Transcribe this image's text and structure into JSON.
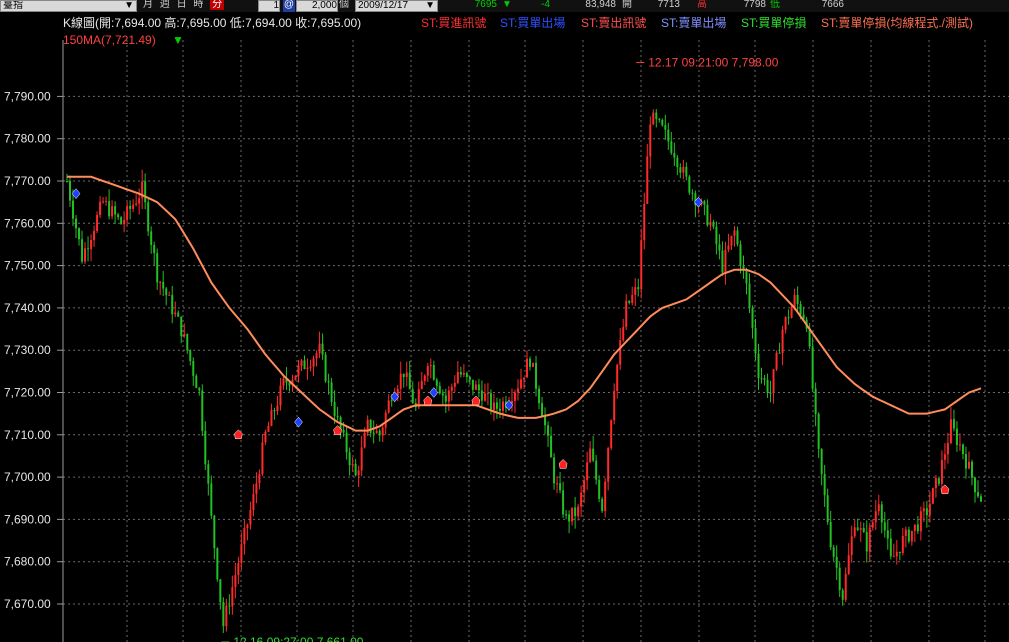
{
  "toolbar": {
    "symbol": "臺指",
    "periods": [
      "月",
      "週",
      "日",
      "時",
      "分"
    ],
    "period_selected": "分",
    "interval": "1",
    "quantity": "2,000",
    "unit": "個",
    "date": "2009/12/17",
    "last": "7695",
    "change": "-4",
    "volume": "83,948",
    "open_label": "開",
    "open_value": "7713",
    "high_label": "高",
    "high_value": "7798",
    "low_label": "低",
    "low_value": "7666",
    "colors": {
      "down": "#00d000",
      "up": "#ff3030",
      "high": "#ff3030",
      "low": "#00d000"
    }
  },
  "info": {
    "kline": "K線圖(開:7,694.00 高:7,695.00 低:7,694.00 收:7,695.00)",
    "st_buy_signal": "ST:買進訊號",
    "st_buy_exit": "ST:買單出場",
    "st_sell_signal": "ST:賣出訊號",
    "st_sell_exit": "ST:賣單出場",
    "st_buy_stop": "ST:買單停損",
    "st_sell_stop": "ST:賣單停損(均線程式./測試)",
    "ma_label": "150MA(7,721.49)",
    "colors": {
      "kline": "#e8e8e8",
      "buy_signal": "#ff3030",
      "buy_exit": "#3050ff",
      "sell_signal": "#ff5050",
      "sell_exit": "#8090ff",
      "buy_stop": "#30e030",
      "sell_stop": "#ff7050",
      "ma": "#ff4040"
    }
  },
  "chart_data": {
    "type": "line",
    "title": "",
    "y_ticks": [
      7670,
      7680,
      7690,
      7700,
      7710,
      7720,
      7730,
      7740,
      7750,
      7760,
      7770,
      7780,
      7790
    ],
    "tick_labels": [
      "7,670.00",
      "7,680.00",
      "7,690.00",
      "7,700.00",
      "7,710.00",
      "7,720.00",
      "7,730.00",
      "7,740.00",
      "7,750.00",
      "7,760.00",
      "7,770.00",
      "7,780.00",
      "7,790.00"
    ],
    "ylim": [
      7661,
      7800
    ],
    "grid": true,
    "n_bars": 305,
    "series": [
      {
        "name": "price",
        "color": "#22c022",
        "x": [
          0,
          5,
          12,
          18,
          25,
          30,
          38,
          44,
          48,
          52,
          58,
          62,
          66,
          72,
          78,
          84,
          90,
          96,
          100,
          104,
          108,
          112,
          116,
          120,
          126,
          130,
          134,
          138,
          142,
          146,
          150,
          154,
          158,
          162,
          166,
          170,
          174,
          178,
          182,
          186,
          190,
          194,
          198,
          202,
          206,
          210,
          214,
          218,
          222,
          226,
          230,
          234,
          238,
          242,
          246,
          250,
          254,
          258,
          262,
          266,
          270,
          274,
          278,
          282,
          286,
          290,
          294,
          298,
          302,
          304
        ],
        "y": [
          7770,
          7752,
          7765,
          7760,
          7768,
          7748,
          7735,
          7720,
          7690,
          7665,
          7683,
          7695,
          7710,
          7722,
          7726,
          7730,
          7713,
          7700,
          7712,
          7710,
          7720,
          7725,
          7716,
          7728,
          7718,
          7725,
          7722,
          7720,
          7716,
          7718,
          7722,
          7728,
          7716,
          7700,
          7690,
          7692,
          7706,
          7693,
          7722,
          7740,
          7745,
          7785,
          7782,
          7777,
          7770,
          7765,
          7760,
          7750,
          7758,
          7745,
          7725,
          7720,
          7735,
          7742,
          7737,
          7705,
          7685,
          7672,
          7690,
          7684,
          7695,
          7680,
          7685,
          7688,
          7692,
          7700,
          7712,
          7706,
          7698,
          7695
        ]
      },
      {
        "name": "150MA",
        "color": "#ff8c5a",
        "x": [
          0,
          8,
          16,
          24,
          30,
          36,
          42,
          48,
          54,
          60,
          66,
          72,
          78,
          84,
          90,
          96,
          100,
          104,
          108,
          112,
          116,
          120,
          124,
          128,
          132,
          136,
          140,
          144,
          150,
          156,
          162,
          166,
          170,
          174,
          178,
          182,
          186,
          190,
          194,
          198,
          202,
          206,
          210,
          214,
          218,
          222,
          226,
          230,
          234,
          238,
          242,
          246,
          250,
          256,
          262,
          268,
          274,
          280,
          286,
          292,
          296,
          300,
          304
        ],
        "y": [
          7771,
          7771,
          7769,
          7767,
          7765,
          7761,
          7754,
          7746,
          7740,
          7735,
          7729,
          7724,
          7720,
          7716,
          7713,
          7711,
          7711,
          7712,
          7714,
          7716,
          7717,
          7717,
          7717,
          7717,
          7717,
          7717,
          7716,
          7715,
          7714,
          7714,
          7715,
          7716,
          7718,
          7721,
          7725,
          7729,
          7732,
          7735,
          7738,
          7740,
          7741,
          7742,
          7744,
          7746,
          7748,
          7749,
          7749,
          7748,
          7746,
          7743,
          7740,
          7736,
          7732,
          7726,
          7722,
          7719,
          7717,
          7715,
          7715,
          7716,
          7718,
          7720,
          7721
        ]
      }
    ],
    "markers": [
      {
        "type": "buy_exit",
        "bar": 3,
        "price": 7767
      },
      {
        "type": "sell_signal",
        "bar": 57,
        "price": 7710
      },
      {
        "type": "buy_exit",
        "bar": 77,
        "price": 7713
      },
      {
        "type": "sell_signal",
        "bar": 90,
        "price": 7711
      },
      {
        "type": "buy_exit",
        "bar": 109,
        "price": 7719
      },
      {
        "type": "sell_signal",
        "bar": 120,
        "price": 7718
      },
      {
        "type": "buy_exit",
        "bar": 122,
        "price": 7720
      },
      {
        "type": "sell_signal",
        "bar": 136,
        "price": 7718
      },
      {
        "type": "buy_exit",
        "bar": 147,
        "price": 7717
      },
      {
        "type": "sell_signal",
        "bar": 165,
        "price": 7703
      },
      {
        "type": "buy_exit",
        "bar": 210,
        "price": 7765
      },
      {
        "type": "sell_signal",
        "bar": 292,
        "price": 7697
      }
    ],
    "annotations": [
      {
        "text": "12.17 09:21:00  7,798.00",
        "bar": 190,
        "price": 7798,
        "color": "#ff4040"
      },
      {
        "text": "12.16 09:27:00  7,661.00",
        "bar": 52,
        "price": 7661,
        "color": "#30e030"
      }
    ]
  }
}
